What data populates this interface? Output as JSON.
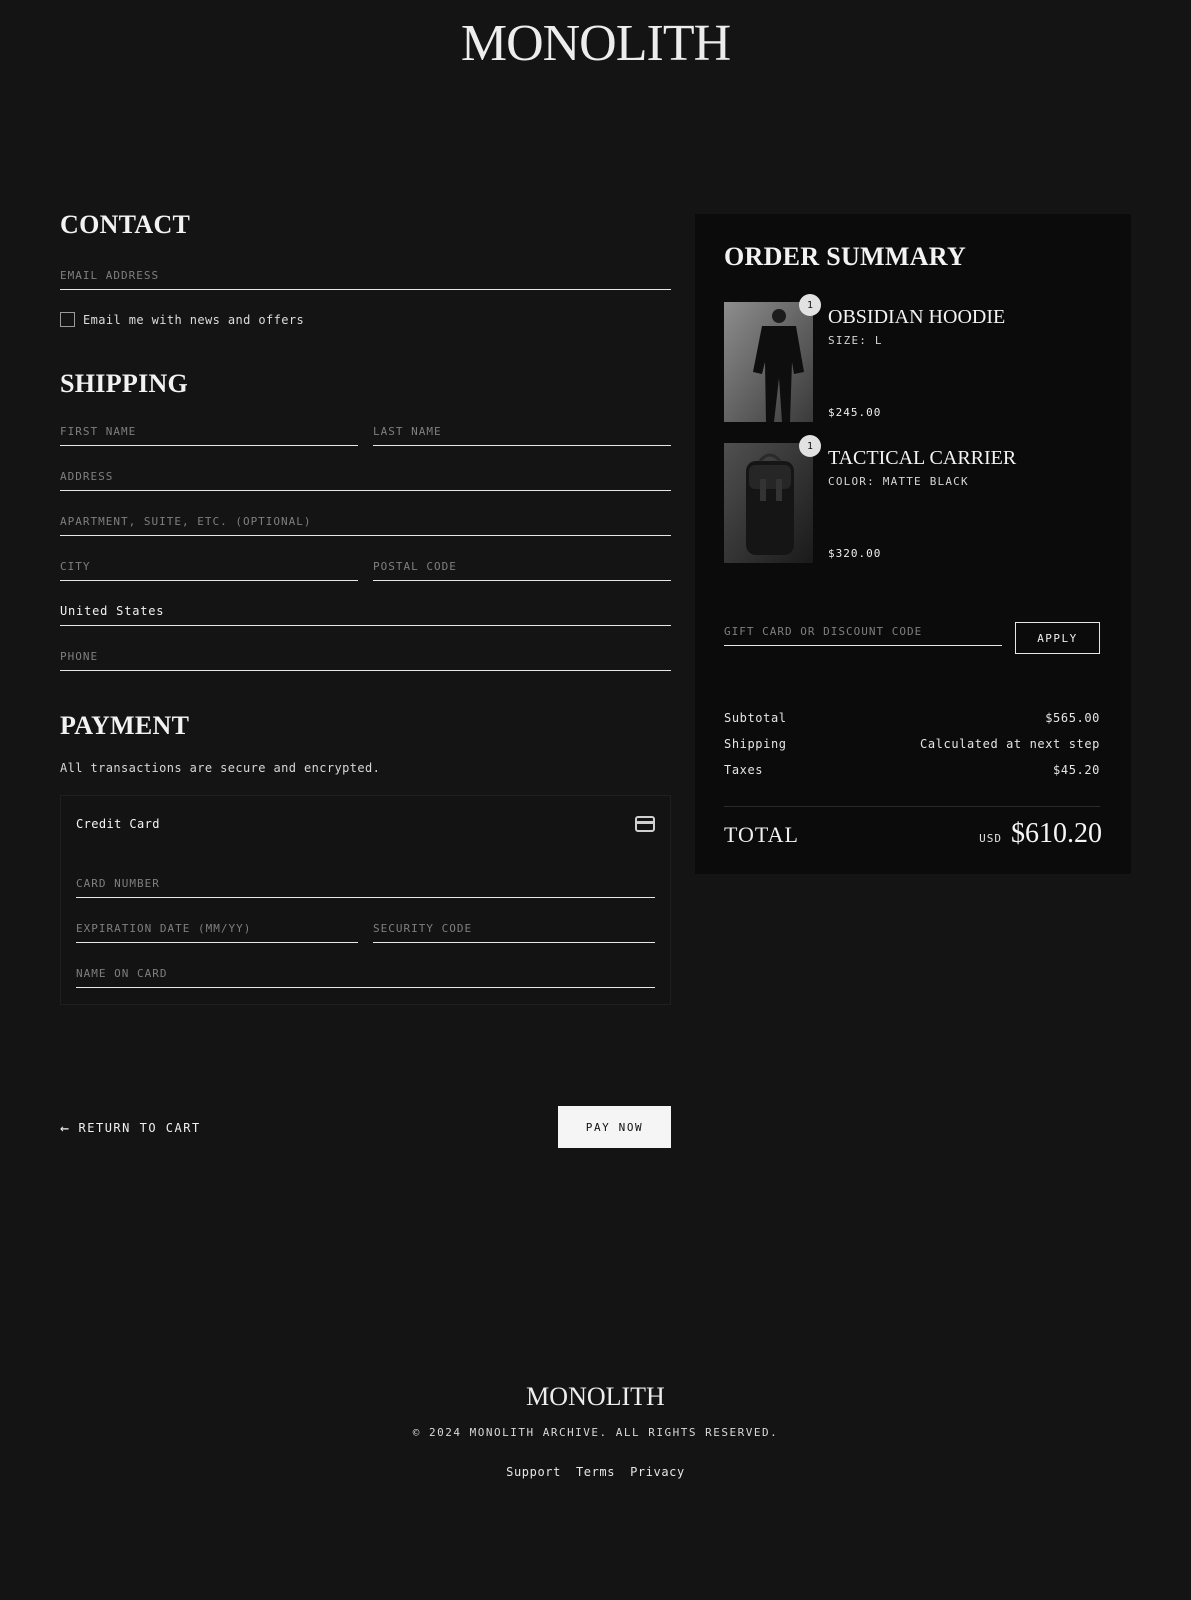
{
  "brand": "MONOLITH",
  "contact": {
    "title": "CONTACT",
    "email_placeholder": "EMAIL ADDRESS",
    "newsletter_label": "Email me with news and offers"
  },
  "shipping": {
    "title": "SHIPPING",
    "first_name": "FIRST NAME",
    "last_name": "LAST NAME",
    "address": "ADDRESS",
    "apartment": "APARTMENT, SUITE, ETC. (OPTIONAL)",
    "city": "CITY",
    "postal_code": "POSTAL CODE",
    "country": "United States",
    "phone": "PHONE"
  },
  "payment": {
    "title": "PAYMENT",
    "note": "All transactions are secure and encrypted.",
    "method": "Credit Card",
    "method_icon": "credit-card-icon",
    "card_number": "CARD NUMBER",
    "expiration": "EXPIRATION DATE (MM/YY)",
    "security_code": "SECURITY CODE",
    "name_on_card": "NAME ON CARD"
  },
  "actions": {
    "return_label": "RETURN TO CART",
    "return_icon": "arrow-left-icon",
    "pay_label": "PAY NOW"
  },
  "summary": {
    "title": "ORDER SUMMARY",
    "items": [
      {
        "name": "OBSIDIAN HOODIE",
        "variant": "SIZE: L",
        "price": "$245.00",
        "quantity": "1"
      },
      {
        "name": "TACTICAL CARRIER",
        "variant": "COLOR: MATTE BLACK",
        "price": "$320.00",
        "quantity": "1"
      }
    ],
    "discount_placeholder": "GIFT CARD OR DISCOUNT CODE",
    "apply_label": "APPLY",
    "subtotal_label": "Subtotal",
    "subtotal_value": "$565.00",
    "shipping_label": "Shipping",
    "shipping_value": "Calculated at next step",
    "taxes_label": "Taxes",
    "taxes_value": "$45.20",
    "total_label": "TOTAL",
    "currency": "USD",
    "total_value": "$610.20"
  },
  "footer": {
    "brand": "MONOLITH",
    "copyright": "© 2024 MONOLITH ARCHIVE. ALL RIGHTS RESERVED.",
    "links": [
      "Support",
      "Terms",
      "Privacy"
    ]
  },
  "colors": {
    "background": "#141414",
    "panel": "#0b0b0b",
    "text": "#e9e9e9",
    "muted": "#7f7f7f",
    "button": "#f5f5f5"
  }
}
